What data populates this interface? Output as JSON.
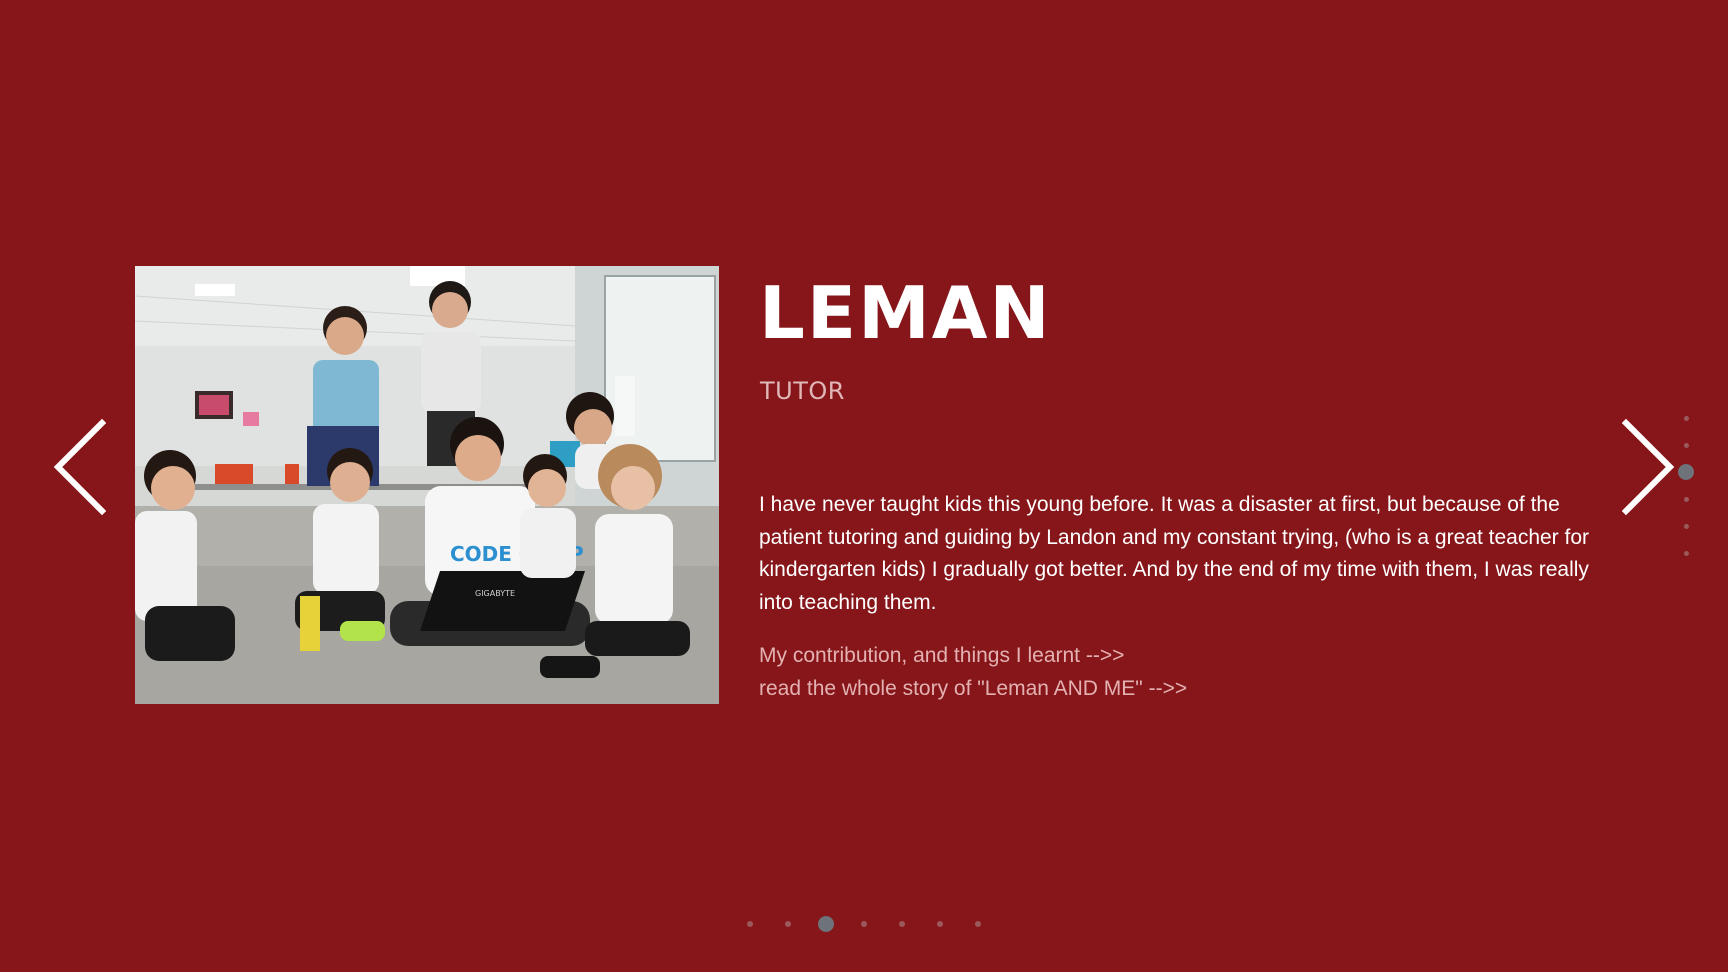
{
  "slide": {
    "title": "LEMAN",
    "subtitle": "TUTOR",
    "description": "I have never taught kids this young before. It was a disaster at first, but because of the patient tutoring and guiding by Landon and my constant trying, (who is a great teacher for kindergarten kids) I gradually got better. And by the end of my time with them, I was really into teaching them.",
    "link_contribution": "My contribution, and things I learnt -->>",
    "link_story": "read the whole story of \"Leman AND ME\" -->>"
  },
  "photo": {
    "shirt_text": "CODE CAMP",
    "laptop_text": "GIGABYTE"
  },
  "navigation": {
    "prev_icon": "chevron-left-icon",
    "next_icon": "chevron-right-icon",
    "horizontal_dot_count": 7,
    "horizontal_active_index": 2,
    "vertical_dot_count": 6,
    "vertical_active_index": 2
  },
  "colors": {
    "background": "#87161a",
    "text": "#ffffff",
    "subtitle": "#e0b8b8",
    "link": "#e3b1b1",
    "dot_inactive": "#9a5a5c",
    "dot_active": "#6d7378"
  }
}
